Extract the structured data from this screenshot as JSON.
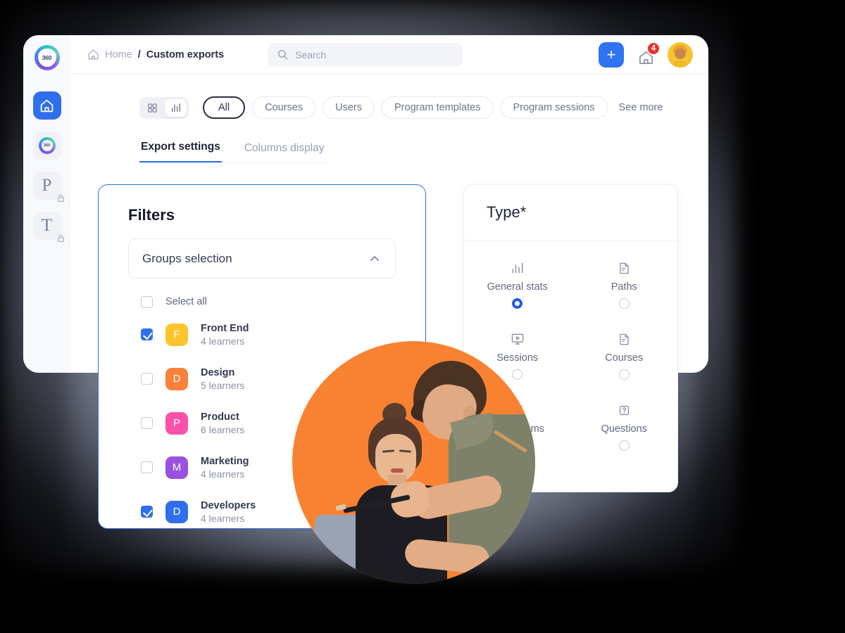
{
  "sidebar": {
    "logo_label": "360",
    "items": [
      {
        "name": "home",
        "glyph": "home-icon",
        "active": true,
        "locked": false,
        "label": ""
      },
      {
        "name": "360",
        "glyph": "360-icon",
        "active": false,
        "locked": false,
        "label": "360"
      },
      {
        "name": "p",
        "glyph": "letter",
        "active": false,
        "locked": true,
        "label": "P"
      },
      {
        "name": "t",
        "glyph": "letter",
        "active": false,
        "locked": true,
        "label": "T"
      }
    ]
  },
  "topbar": {
    "breadcrumb": {
      "home": "Home",
      "separator": "/",
      "current": "Custom exports"
    },
    "search": {
      "value": "",
      "placeholder": "Search"
    },
    "add_label": "+",
    "notification_count": "4"
  },
  "filter_row": {
    "view_toggle": {
      "grid_active": false,
      "chart_active": true
    },
    "pills": [
      {
        "label": "All",
        "active": true
      },
      {
        "label": "Courses",
        "active": false
      },
      {
        "label": "Users",
        "active": false
      },
      {
        "label": "Program templates",
        "active": false
      },
      {
        "label": "Program sessions",
        "active": false
      }
    ],
    "see_more": "See more"
  },
  "subtabs": [
    {
      "label": "Export settings",
      "active": true
    },
    {
      "label": "Columns display",
      "active": false
    }
  ],
  "filters_panel": {
    "title": "Filters",
    "accordion": {
      "label": "Groups selection",
      "expanded": true
    },
    "select_all": {
      "label": "Select all",
      "checked": false
    },
    "groups": [
      {
        "initial": "F",
        "name": "Front End",
        "learners": "4 learners",
        "checked": true,
        "color": "#FFC32B"
      },
      {
        "initial": "D",
        "name": "Design",
        "learners": "5 learners",
        "checked": false,
        "color": "#F9813A"
      },
      {
        "initial": "P",
        "name": "Product",
        "learners": "6 learners",
        "checked": false,
        "color": "#FA52A8"
      },
      {
        "initial": "M",
        "name": "Marketing",
        "learners": "4 learners",
        "checked": false,
        "color": "#9B51E0"
      },
      {
        "initial": "D",
        "name": "Developers",
        "learners": "4 learners",
        "checked": true,
        "color": "#2F6FED"
      }
    ]
  },
  "type_panel": {
    "title": "Type*",
    "options": [
      {
        "label": "General stats",
        "icon": "bar-chart-icon",
        "selected": true
      },
      {
        "label": "Paths",
        "icon": "document-icon",
        "selected": false
      },
      {
        "label": "Sessions",
        "icon": "screen-play-icon",
        "selected": false
      },
      {
        "label": "Courses",
        "icon": "document-icon",
        "selected": false
      },
      {
        "label": "Classrooms",
        "icon": "building-icon",
        "selected": false
      },
      {
        "label": "Questions",
        "icon": "question-icon",
        "selected": false
      }
    ]
  },
  "colors": {
    "accent": "#2F6FED",
    "badge": "#E8322C",
    "photo_bg": "#F98232"
  }
}
